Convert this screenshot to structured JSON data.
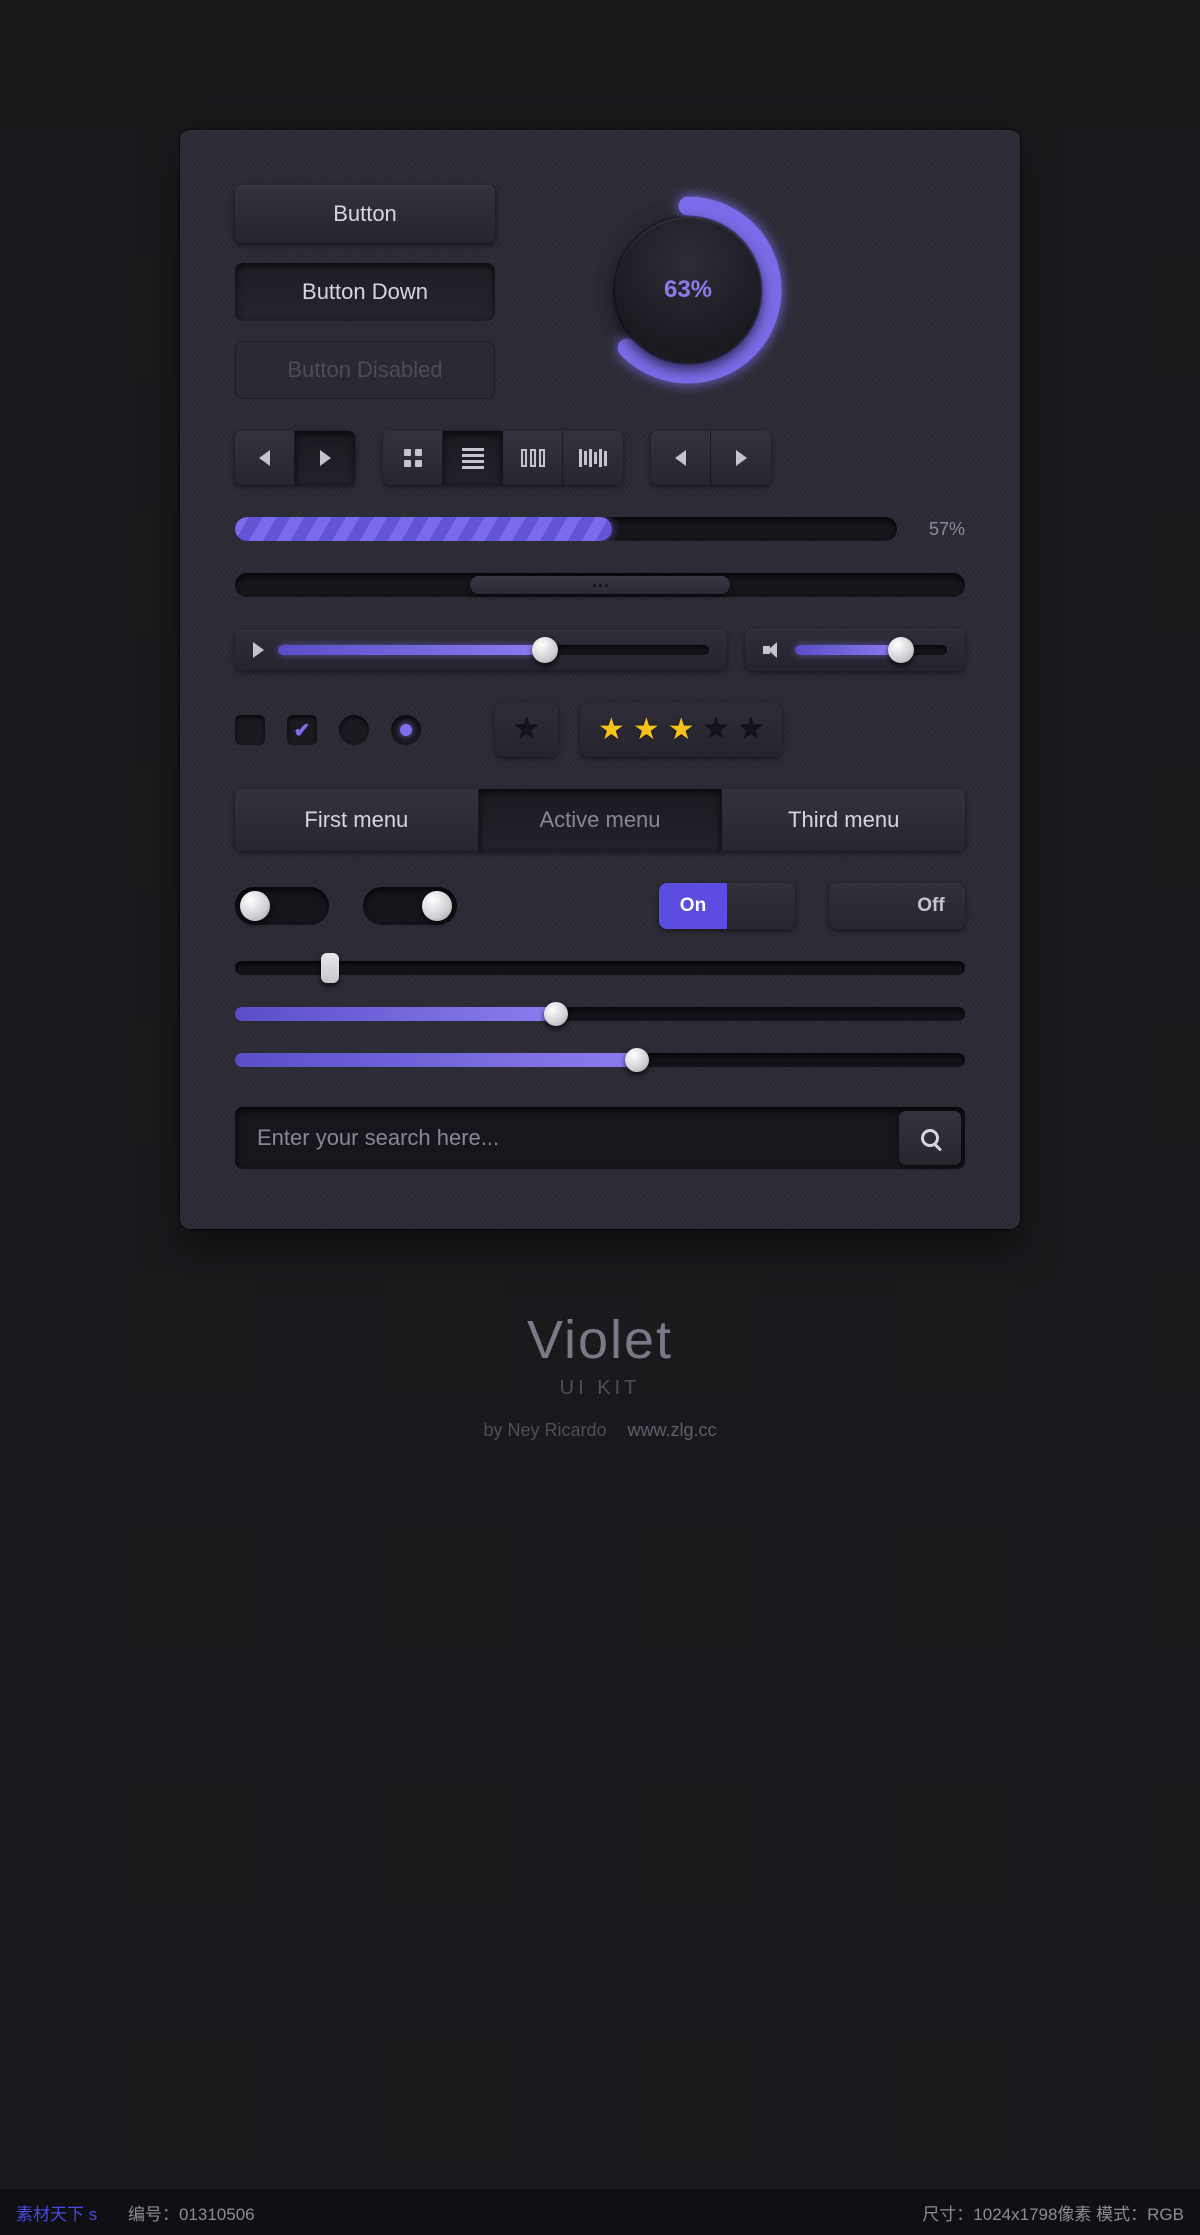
{
  "colors": {
    "accent": "#7a6ce8",
    "star_on": "#f6c21a"
  },
  "buttons": {
    "normal": "Button",
    "down": "Button Down",
    "disabled": "Button Disabled"
  },
  "dial": {
    "percent": 63,
    "label": "63%"
  },
  "icon_groups": {
    "nav1": [
      "prev",
      "next"
    ],
    "view": [
      "grid",
      "list",
      "columns",
      "barcode"
    ],
    "nav2": [
      "prev",
      "next"
    ]
  },
  "progress": {
    "percent": 57,
    "label": "57%"
  },
  "media": {
    "seek_percent": 62,
    "volume_percent": 70
  },
  "checks": {
    "unchecked": false,
    "checked": true
  },
  "radios": {
    "unchecked": false,
    "checked": true
  },
  "ratings": {
    "empty": 0,
    "filled": 3,
    "max": 5
  },
  "menu": {
    "items": [
      "First menu",
      "Active menu",
      "Third menu"
    ],
    "active_index": 1
  },
  "toggles": {
    "round1": "off",
    "round2": "on",
    "seg_on_label": "On",
    "seg_off_label": "Off"
  },
  "sliders": {
    "a": 13,
    "b": 44,
    "c": 55
  },
  "search": {
    "placeholder": "Enter your search here..."
  },
  "title": {
    "name": "Violet",
    "sub": "UI KIT",
    "author": "by Ney Ricardo",
    "url": "www.zlg.cc"
  },
  "footer": {
    "left": "素材天下 s",
    "id_label": "编号：",
    "id": "01310506",
    "right": "尺寸：1024x1798像素  模式：RGB"
  }
}
